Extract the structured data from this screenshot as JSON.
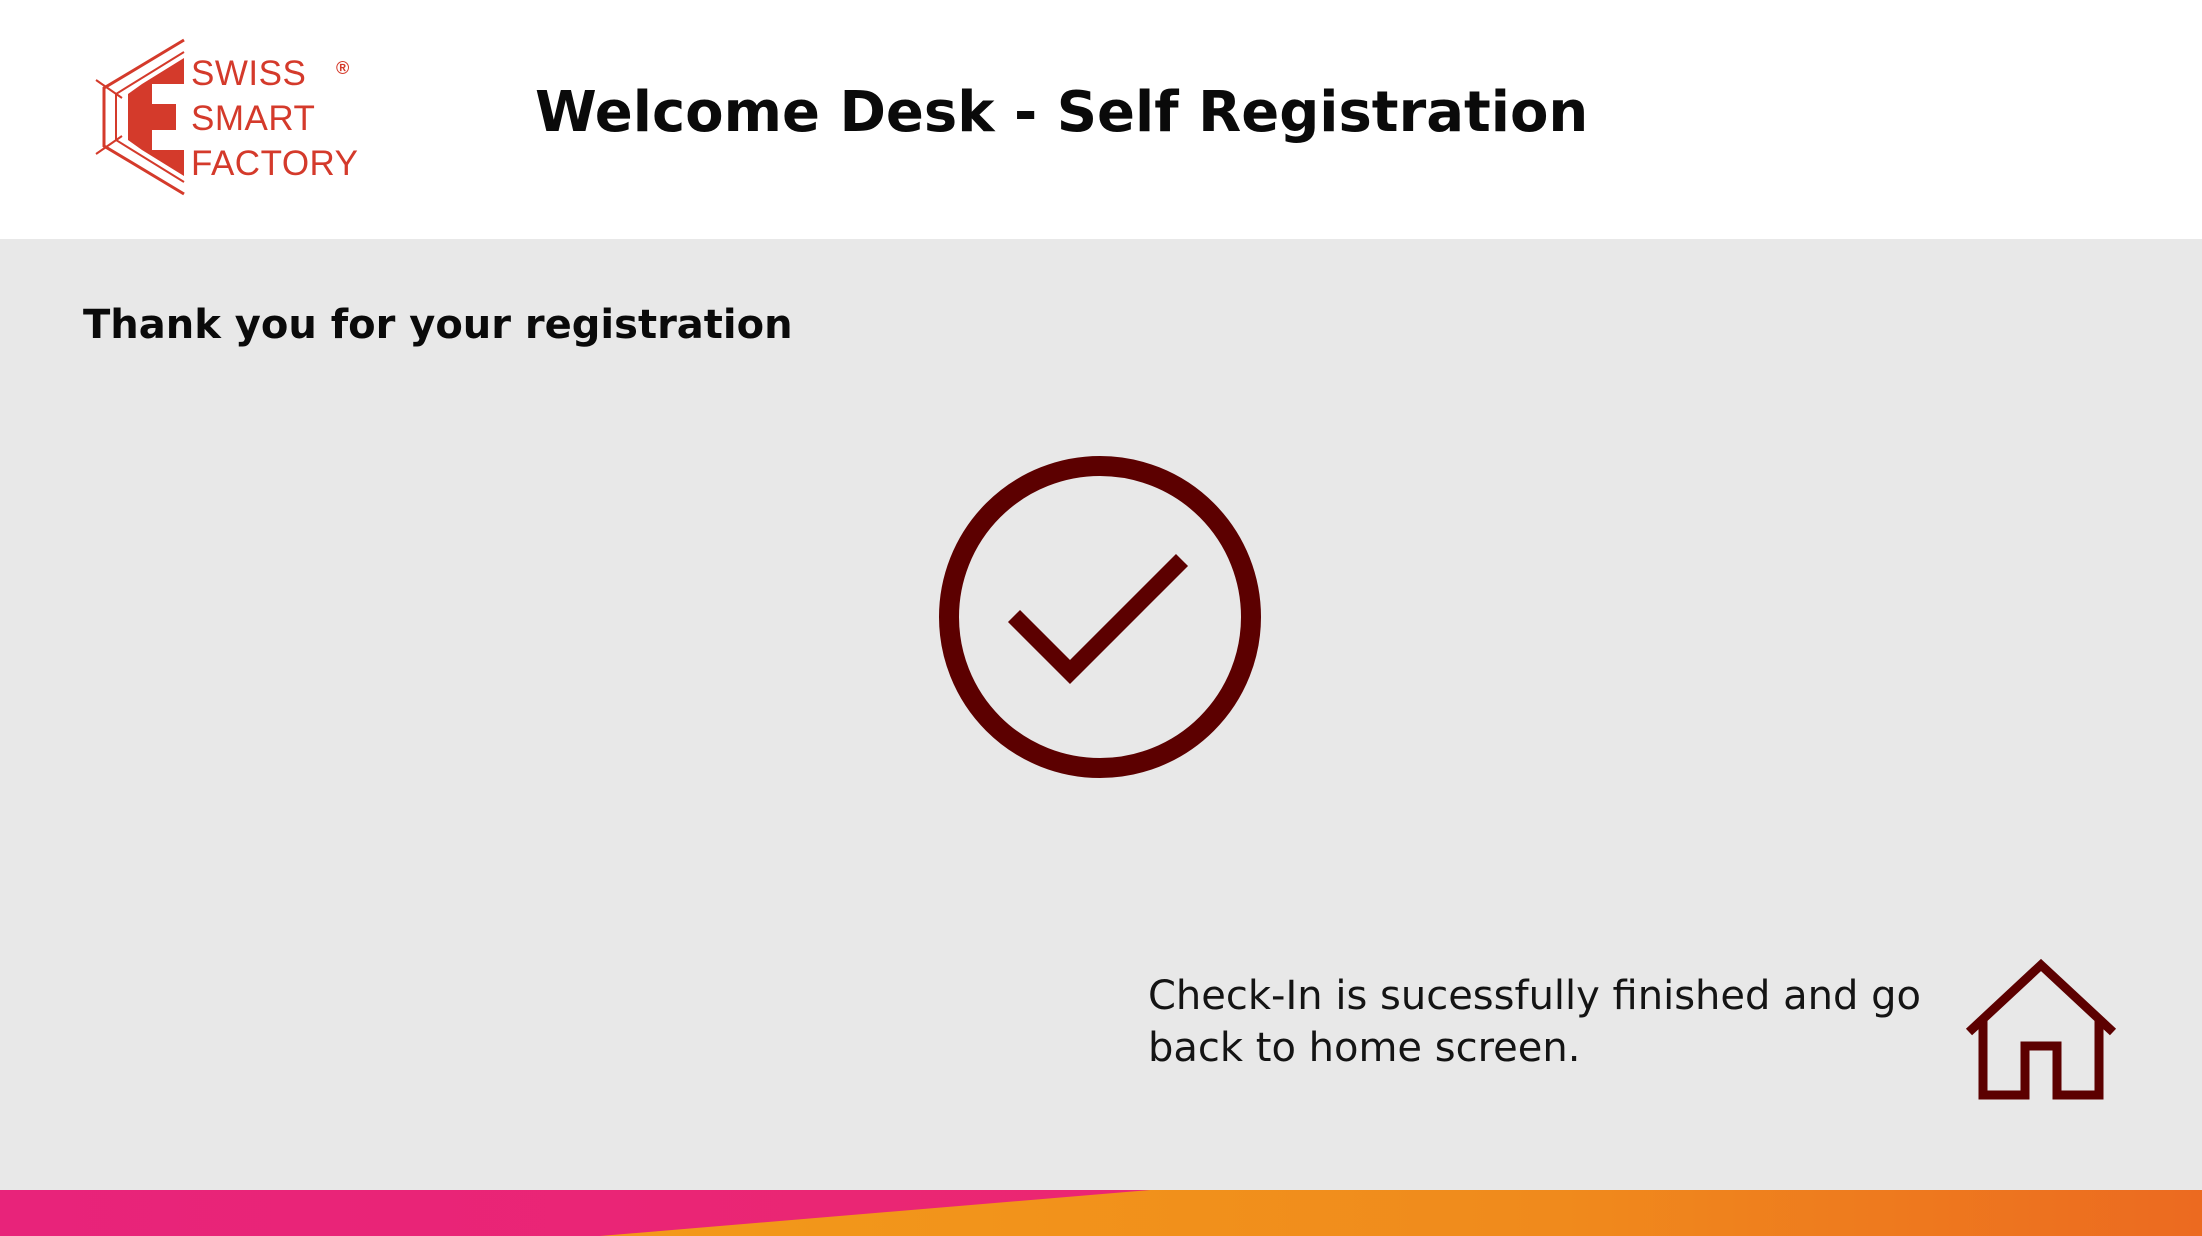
{
  "header": {
    "logo": {
      "line1": "SWISS",
      "line2": "SMART",
      "line3": "FACTORY",
      "registered_mark": "®"
    },
    "title": "Welcome Desk - Self Registration"
  },
  "main": {
    "subtitle": "Thank you for your registration",
    "status_icon": "check-circle-icon",
    "message": "Check-In is sucessfully finished and go back to home screen.",
    "home_icon": "home-icon"
  },
  "colors": {
    "brand_red": "#d43a2b",
    "icon_dark_red": "#5c0000",
    "background": "#e8e8e8",
    "header_bg": "#ffffff",
    "bar_pink": "#e8237a",
    "bar_orange": "#f08a1c"
  }
}
